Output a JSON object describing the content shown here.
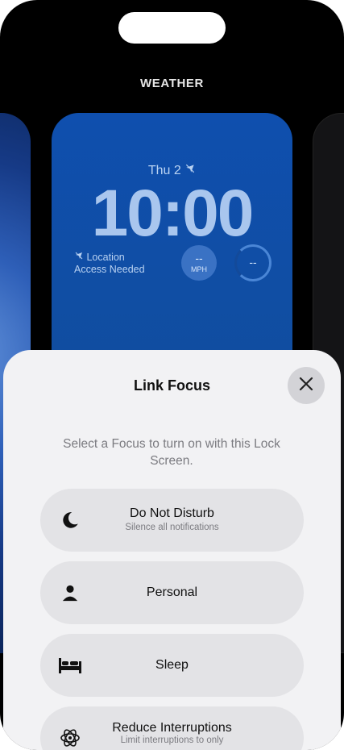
{
  "gallery": {
    "label": "WEATHER"
  },
  "lock_screen": {
    "date": "Thu 2",
    "time": "10:00",
    "location_line1": "Location",
    "location_line2": "Access Needed",
    "wind_value": "--",
    "wind_unit": "MPH",
    "uv_value": "--"
  },
  "sheet": {
    "title": "Link Focus",
    "prompt": "Select a Focus to turn on with this Lock Screen.",
    "options": [
      {
        "label": "Do Not Disturb",
        "subtitle": "Silence all notifications",
        "icon": "moon-icon"
      },
      {
        "label": "Personal",
        "subtitle": "",
        "icon": "person-icon"
      },
      {
        "label": "Sleep",
        "subtitle": "",
        "icon": "bed-icon"
      },
      {
        "label": "Reduce Interruptions",
        "subtitle": "Limit interruptions to only",
        "icon": "atom-icon"
      }
    ]
  }
}
